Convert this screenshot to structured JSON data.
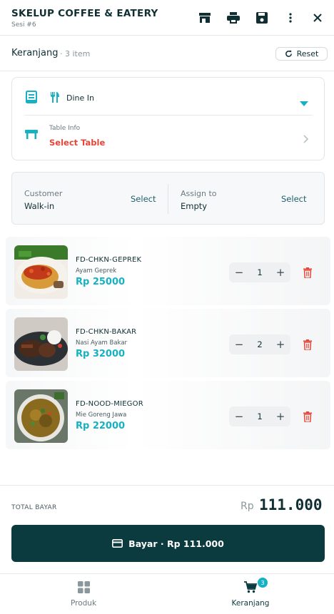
{
  "header": {
    "brand": "SKELUP COFFEE & EATERY",
    "session": "Sesi #6",
    "icons": [
      "store-icon",
      "printer-icon",
      "save-icon",
      "more-vertical-icon",
      "close-icon"
    ]
  },
  "cart": {
    "title": "Keranjang",
    "count": "· 3 item",
    "reset_label": "Reset"
  },
  "order": {
    "dine_type": "Dine In",
    "table_info_label": "Table Info",
    "select_table": "Select Table"
  },
  "assign": {
    "customer_label": "Customer",
    "customer_value": "Walk-in",
    "customer_select": "Select",
    "assign_label": "Assign to",
    "assign_value": "Empty",
    "assign_select": "Select"
  },
  "items": [
    {
      "sku": "FD-CHKN-GEPREK",
      "name": "Ayam Geprek",
      "price": "Rp 25000",
      "qty": "1"
    },
    {
      "sku": "FD-CHKN-BAKAR",
      "name": "Nasi Ayam Bakar",
      "price": "Rp 32000",
      "qty": "2"
    },
    {
      "sku": "FD-NOOD-MIEGOR",
      "name": "Mie Goreng Jawa",
      "price": "Rp 22000",
      "qty": "1"
    }
  ],
  "total": {
    "label": "TOTAL BAYAR",
    "currency": "Rp",
    "value": "111.000"
  },
  "pay_button": "Bayar · Rp 111.000",
  "nav": {
    "produk": "Produk",
    "keranjang": "Keranjang",
    "badge": "3"
  },
  "colors": {
    "accent": "#16b1c3",
    "primary_dark": "#0b3a3f",
    "danger": "#e5483a"
  }
}
